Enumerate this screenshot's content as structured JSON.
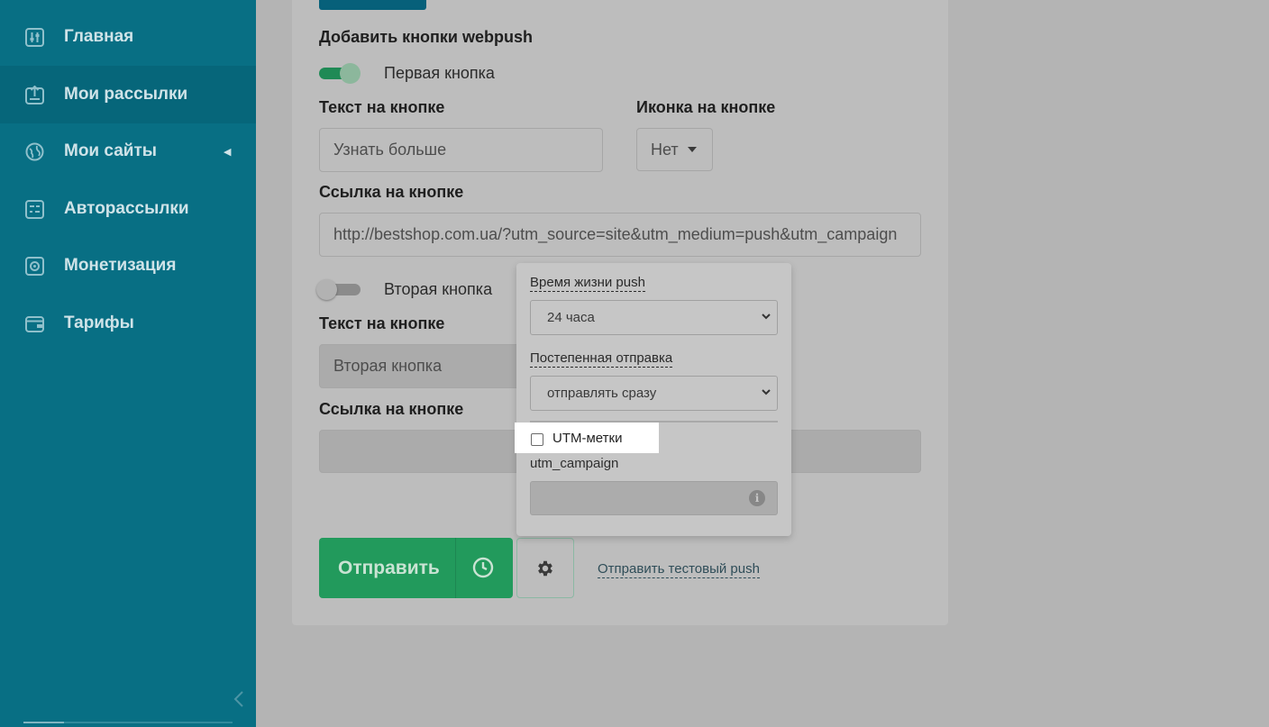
{
  "sidebar": {
    "items": [
      {
        "label": "Главная",
        "icon": "sliders-icon"
      },
      {
        "label": "Мои рассылки",
        "icon": "upload-box-icon",
        "active": true
      },
      {
        "label": "Мои сайты",
        "icon": "globe-icon",
        "has_submenu": true
      },
      {
        "label": "Авторассылки",
        "icon": "calendar-icon"
      },
      {
        "label": "Монетизация",
        "icon": "safe-icon"
      },
      {
        "label": "Тарифы",
        "icon": "wallet-icon"
      }
    ]
  },
  "form": {
    "webpush_heading": "Добавить кнопки webpush",
    "first_button": {
      "toggle_label": "Первая кнопка",
      "enabled": true,
      "text_label": "Текст на кнопке",
      "text_value": "Узнать больше",
      "icon_label": "Иконка на кнопке",
      "icon_value": "Нет",
      "link_label": "Ссылка на кнопке",
      "link_value": "http://bestshop.com.ua/?utm_source=site&utm_medium=push&utm_campaign"
    },
    "second_button": {
      "toggle_label": "Вторая кнопка",
      "enabled": false,
      "text_label": "Текст на кнопке",
      "text_placeholder": "Вторая кнопка",
      "link_label": "Ссылка на кнопке",
      "link_value": ""
    }
  },
  "actions": {
    "send_label": "Отправить",
    "test_push_label": "Отправить тестовый push"
  },
  "settings_popup": {
    "lifetime_label": "Время жизни push",
    "lifetime_value": "24 часа",
    "gradual_label": "Постепенная отправка",
    "gradual_value": "отправлять сразу",
    "utm_label": "UTM-метки",
    "utm_checked": false,
    "utm_campaign_label": "utm_campaign",
    "utm_campaign_value": ""
  }
}
